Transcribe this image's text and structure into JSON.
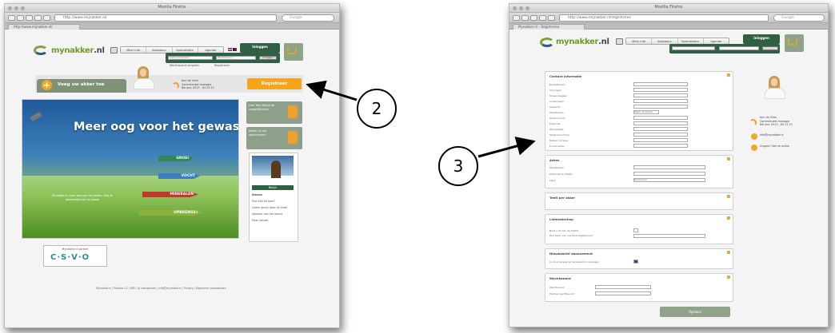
{
  "window1": {
    "title": "Mozilla Firefox",
    "url": "http://www.mijnakker.nl/",
    "search_placeholder": "Google",
    "tab_label": "http://www.mijnakker.nl/",
    "logo": {
      "brand": "mynakker",
      "tld": ".nl"
    },
    "nav": [
      "Meer info",
      "Adviseurs",
      "Specialisten",
      "Agenda",
      "Inloggen"
    ],
    "login": {
      "title": "Inloggen",
      "user_placeholder": "Gebruikersnaam",
      "pass_placeholder": "Wachtwoord",
      "button": "Inloggen"
    },
    "login_links": [
      "Wachtwoord vergeten",
      "Registreren"
    ],
    "add_field_button": "Voeg uw akker toe",
    "contact": {
      "name": "Ann de Vries",
      "role": "Commercieel manager",
      "phone": "Bel ons: 0513 - 63 23 23"
    },
    "register_button": "Registreer",
    "hero": {
      "title": "Meer oog voor het gewas",
      "arrows": [
        "GROEI",
        "VOCHT",
        "MINERALEN",
        "OPBRENGST"
      ],
      "text": "Mynakker.nl: meer oog voor het gewas. Volg de gezondheid van uw gewas"
    },
    "side_cards": [
      "Free Tour Bekijk de mogelijkheden",
      "Bestel nu uw abonnement"
    ],
    "news": {
      "button": "Bekijk",
      "heading": "Nieuws",
      "items": [
        "Hoe kijkt de boer?",
        "Lorem ipsum dolor sit amet",
        "Adviseur aan het woord",
        "Meer nieuws"
      ]
    },
    "partner": {
      "caption": "Mynakker.nl partner",
      "logo_text": "C·S·V·O"
    },
    "footer": "Mynakker.nl | Postbus 11 | 8911 AJ Leeuwarden | info@mynakker.nl | Privacy | Algemene voorwaarden"
  },
  "window2": {
    "title": "Mozilla Firefox",
    "url": "http://www.mijnakker.nl/registreren",
    "search_placeholder": "Google",
    "tab_label": "Mynakker.nl – Registreren",
    "nav": [
      "Meer info",
      "Adviseurs",
      "Specialisten",
      "Agenda",
      "Inloggen"
    ],
    "sections": [
      {
        "title": "Contact informatie",
        "fields": [
          "Bedrijfsnaam",
          "Voornaam",
          "Tussenvoegsel",
          "Achternaam",
          "Geslacht",
          "Straatnaam",
          "Huisnummer",
          "Postcode",
          "Woonplaats",
          "Telefoonnummer",
          "Mobiel nummer",
          "E-mail adres"
        ],
        "select_value": "Maak uw keuze"
      },
      {
        "title": "Adres",
        "fields": [
          "Straatnaam",
          "Postcode en Plaats",
          "Land"
        ],
        "select_value": "Nederland"
      },
      {
        "title": "Teelt per akker",
        "fields": []
      },
      {
        "title": "Lidmaatschap",
        "fields": [
          "Bent u lid van de CSVO?",
          "Hoe bent u bij ons terechtgekomen?"
        ]
      },
      {
        "title": "Nieuwsbrief abonnement",
        "fields": [
          "Ja, ik wil graag de nieuwsbrief ontvangen"
        ]
      },
      {
        "title": "Wachtwoord",
        "fields": [
          "Wachtwoord",
          "Herhaal wachtwoord"
        ]
      }
    ],
    "save_button": "Opslaan",
    "contact": {
      "name": "Ann de Vries",
      "role": "Commercieel manager",
      "phone": "Bel ons: 0513 - 63 23 23",
      "email_label": "info@mynakker.nl",
      "extra": "Vragen? Stel ze online"
    }
  },
  "callouts": {
    "first": "2",
    "second": "3"
  },
  "colors": {
    "accent_orange": "#f5a51c",
    "brand_green": "#2f6043",
    "sage": "#8fa38a"
  }
}
